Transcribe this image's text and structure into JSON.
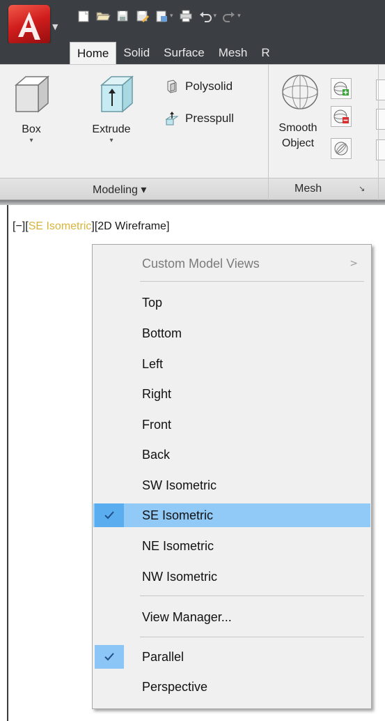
{
  "tabs": [
    "Home",
    "Solid",
    "Surface",
    "Mesh",
    "R"
  ],
  "ribbon": {
    "box_label": "Box",
    "extrude_label": "Extrude",
    "polysolid_label": "Polysolid",
    "presspull_label": "Presspull",
    "smooth_object_line1": "Smooth",
    "smooth_object_line2": "Object",
    "modeling_panel": "Modeling ▾",
    "mesh_panel": "Mesh"
  },
  "viewport": {
    "label_prefix": "[−][",
    "view_name": "SE Isometric",
    "label_suffix": "][2D Wireframe]"
  },
  "menu": {
    "custom_model_views": "Custom Model Views",
    "items": [
      "Top",
      "Bottom",
      "Left",
      "Right",
      "Front",
      "Back",
      "SW Isometric",
      "SE Isometric",
      "NE Isometric",
      "NW Isometric"
    ],
    "selected_item": "SE Isometric",
    "view_manager": "View Manager...",
    "projection_items": [
      "Parallel",
      "Perspective"
    ],
    "checked_projection": "Parallel"
  },
  "colors": {
    "title_bar": "#3b3e42",
    "menu_highlight": "#91c9f7",
    "view_name": "#d9b43a"
  }
}
